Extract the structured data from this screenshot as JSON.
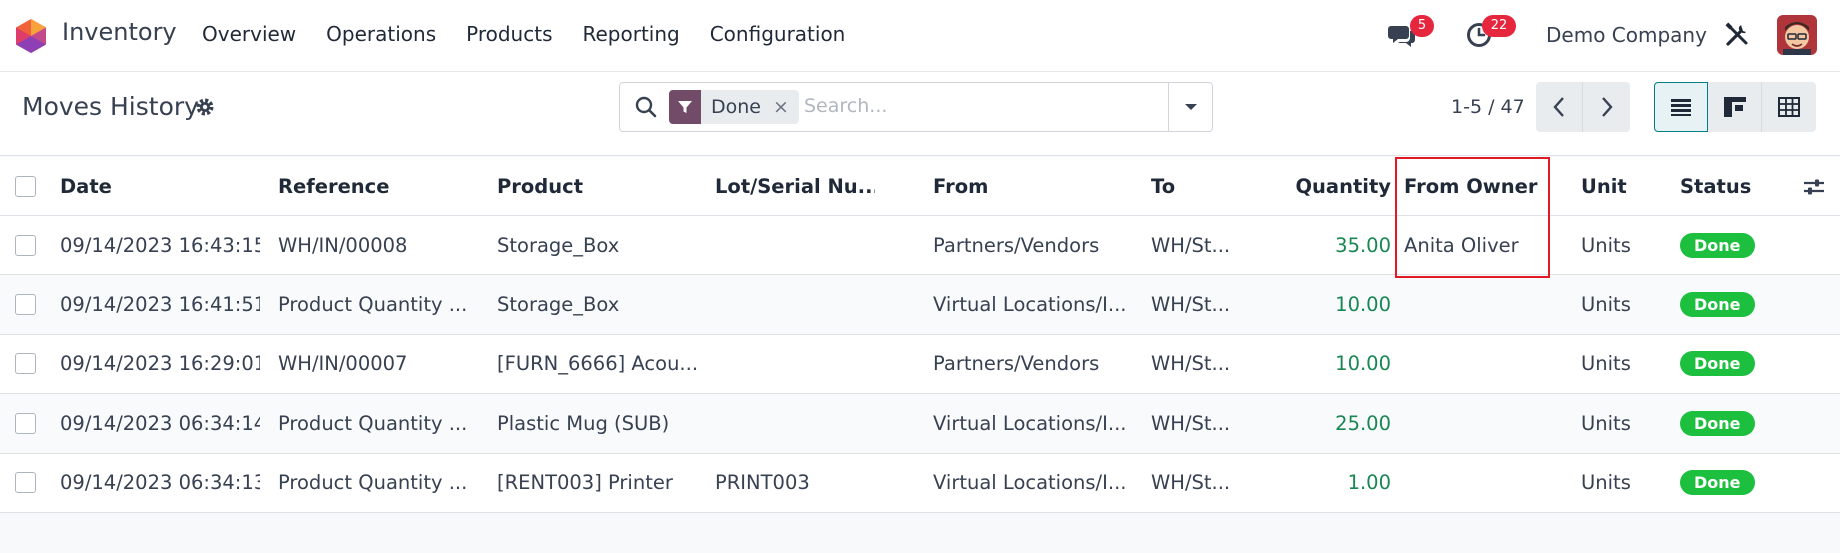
{
  "app": {
    "name": "Inventory"
  },
  "nav": {
    "menu": [
      "Overview",
      "Operations",
      "Products",
      "Reporting",
      "Configuration"
    ],
    "chat_badge": "5",
    "activity_badge": "22",
    "company": "Demo Company"
  },
  "control": {
    "title": "Moves History",
    "search": {
      "facet": "Done",
      "facet_remove": "×",
      "placeholder": "Search..."
    },
    "pager": "1-5 / 47"
  },
  "table": {
    "headers": {
      "date": "Date",
      "reference": "Reference",
      "product": "Product",
      "lot": "Lot/Serial Nu...",
      "from": "From",
      "to": "To",
      "quantity": "Quantity",
      "from_owner": "From Owner",
      "unit": "Unit",
      "status": "Status"
    },
    "rows": [
      {
        "date": "09/14/2023 16:43:15",
        "reference": "WH/IN/00008",
        "product": "Storage_Box",
        "lot": "",
        "from": "Partners/Vendors",
        "to": "WH/St...",
        "quantity": "35.00",
        "from_owner": "Anita Oliver",
        "unit": "Units",
        "status": "Done"
      },
      {
        "date": "09/14/2023 16:41:51",
        "reference": "Product Quantity ...",
        "product": "Storage_Box",
        "lot": "",
        "from": "Virtual Locations/I...",
        "to": "WH/St...",
        "quantity": "10.00",
        "from_owner": "",
        "unit": "Units",
        "status": "Done"
      },
      {
        "date": "09/14/2023 16:29:01",
        "reference": "WH/IN/00007",
        "product": "[FURN_6666] Acou...",
        "lot": "",
        "from": "Partners/Vendors",
        "to": "WH/St...",
        "quantity": "10.00",
        "from_owner": "",
        "unit": "Units",
        "status": "Done"
      },
      {
        "date": "09/14/2023 06:34:14",
        "reference": "Product Quantity ...",
        "product": "Plastic Mug (SUB)",
        "lot": "",
        "from": "Virtual Locations/I...",
        "to": "WH/St...",
        "quantity": "25.00",
        "from_owner": "",
        "unit": "Units",
        "status": "Done"
      },
      {
        "date": "09/14/2023 06:34:13",
        "reference": "Product Quantity ...",
        "product": "[RENT003] Printer",
        "lot": "PRINT003",
        "from": "Virtual Locations/I...",
        "to": "WH/St...",
        "quantity": "1.00",
        "from_owner": "",
        "unit": "Units",
        "status": "Done"
      }
    ]
  },
  "colors": {
    "accent": "#714b67",
    "primary": "#017e84",
    "success": "#1cbf3e",
    "quantity": "#198754",
    "highlight": "#e01b24"
  },
  "icons": [
    "app-logo-icon",
    "chat-icon",
    "clock-icon",
    "tools-icon",
    "gear-icon",
    "search-icon",
    "filter-icon",
    "caret-down-icon",
    "chevron-left-icon",
    "chevron-right-icon",
    "list-view-icon",
    "kanban-view-icon",
    "pivot-view-icon",
    "optional-columns-icon"
  ]
}
